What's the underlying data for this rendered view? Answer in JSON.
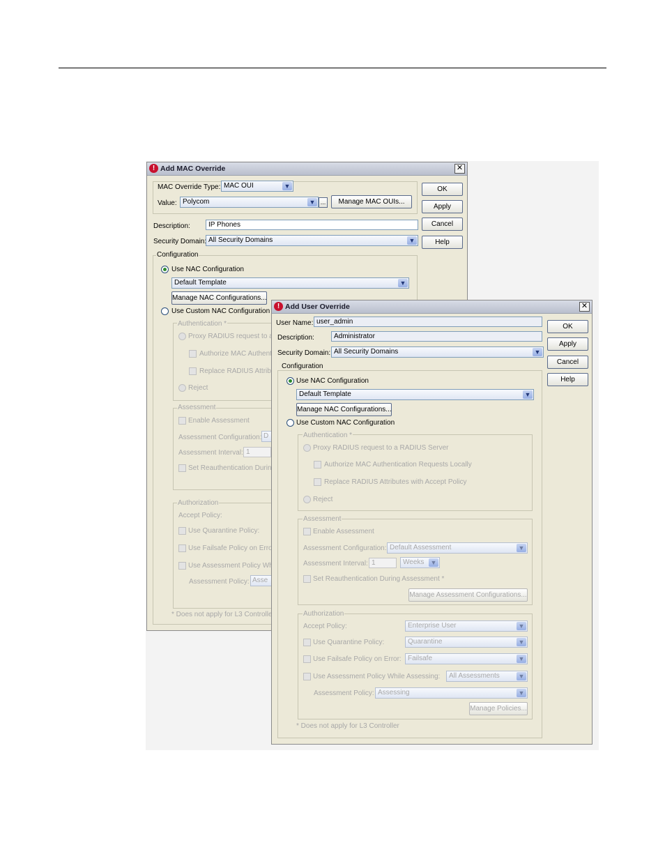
{
  "mac_dialog": {
    "title": "Add MAC Override",
    "close_glyph": "✕",
    "override_type_label": "MAC Override Type:",
    "override_type_value": "MAC OUI",
    "value_label": "Value:",
    "value_value": "Polycom",
    "ellipsis_label": "...",
    "manage_ouis_label": "Manage MAC OUIs...",
    "description_label": "Description:",
    "description_value": "IP Phones",
    "security_domain_label": "Security Domain:",
    "security_domain_value": "All Security Domains",
    "buttons": {
      "ok": "OK",
      "apply": "Apply",
      "cancel": "Cancel",
      "help": "Help"
    },
    "configuration_title": "Configuration",
    "use_nac_label": "Use NAC Configuration",
    "nac_template": "Default Template",
    "manage_nac_label": "Manage NAC Configurations...",
    "use_custom_label": "Use Custom NAC Configuration",
    "authentication_title": "Authentication *",
    "proxy_radius": "Proxy RADIUS request to a R",
    "authorize_mac": "Authorize MAC Authentic",
    "replace_radius": "Replace RADIUS Attribut",
    "reject": "Reject",
    "assessment_title": "Assessment",
    "enable_assessment": "Enable Assessment",
    "assessment_config_label": "Assessment Configuration:",
    "assessment_config_value": "D",
    "assessment_interval_label": "Assessment Interval:",
    "assessment_interval_value": "1",
    "set_reauth": "Set Reauthentication During",
    "authorization_title": "Authorization",
    "accept_policy_label": "Accept Policy:",
    "quarantine_label": "Use Quarantine Policy:",
    "failsafe_label": "Use Failsafe Policy on Error:",
    "assessment_policy_while": "Use Assessment Policy Whi",
    "assessment_policy_label": "Assessment Policy:",
    "assessment_policy_value": "Asse",
    "footnote": "* Does not apply for L3 Controller"
  },
  "user_dialog": {
    "title": "Add User Override",
    "close_glyph": "✕",
    "username_label": "User Name:",
    "username_value": "user_admin",
    "description_label": "Description:",
    "description_value": "Administrator",
    "security_domain_label": "Security Domain:",
    "security_domain_value": "All Security Domains",
    "buttons": {
      "ok": "OK",
      "apply": "Apply",
      "cancel": "Cancel",
      "help": "Help"
    },
    "configuration_title": "Configuration",
    "use_nac_label": "Use NAC Configuration",
    "nac_template": "Default Template",
    "manage_nac_label": "Manage NAC Configurations...",
    "use_custom_label": "Use Custom NAC Configuration",
    "authentication_title": "Authentication *",
    "proxy_radius": "Proxy RADIUS request to a RADIUS Server",
    "authorize_mac": "Authorize MAC Authentication Requests Locally",
    "replace_radius": "Replace RADIUS Attributes with Accept Policy",
    "reject": "Reject",
    "assessment_title": "Assessment",
    "enable_assessment": "Enable Assessment",
    "assessment_config_label": "Assessment Configuration:",
    "assessment_config_value": "Default Assessment",
    "assessment_interval_label": "Assessment Interval:",
    "assessment_interval_value": "1",
    "interval_unit": "Weeks",
    "set_reauth": "Set Reauthentication During Assessment *",
    "manage_assessment_label": "Manage Assessment Configurations...",
    "authorization_title": "Authorization",
    "accept_policy_label": "Accept Policy:",
    "accept_policy_value": "Enterprise User",
    "quarantine_label": "Use Quarantine Policy:",
    "quarantine_value": "Quarantine",
    "failsafe_label": "Use Failsafe Policy on Error:",
    "failsafe_value": "Failsafe",
    "assessment_policy_while": "Use Assessment Policy While Assessing:",
    "assessment_policy_while_value": "All Assessments",
    "assessment_policy_label": "Assessment Policy:",
    "assessment_policy_value": "Assessing",
    "manage_policies_label": "Manage Policies...",
    "footnote": "* Does not apply for L3 Controller"
  }
}
